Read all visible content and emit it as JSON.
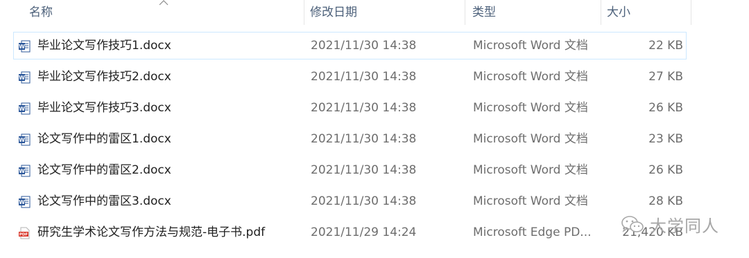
{
  "columns": {
    "name": "名称",
    "date": "修改日期",
    "type": "类型",
    "size": "大小"
  },
  "files": [
    {
      "name": "毕业论文写作技巧1.docx",
      "date": "2021/11/30 14:38",
      "type": "Microsoft Word 文档",
      "size": "22 KB",
      "icon": "word-doc-icon"
    },
    {
      "name": "毕业论文写作技巧2.docx",
      "date": "2021/11/30 14:38",
      "type": "Microsoft Word 文档",
      "size": "27 KB",
      "icon": "word-doc-icon"
    },
    {
      "name": "毕业论文写作技巧3.docx",
      "date": "2021/11/30 14:38",
      "type": "Microsoft Word 文档",
      "size": "26 KB",
      "icon": "word-doc-icon"
    },
    {
      "name": "论文写作中的雷区1.docx",
      "date": "2021/11/30 14:38",
      "type": "Microsoft Word 文档",
      "size": "23 KB",
      "icon": "word-doc-icon"
    },
    {
      "name": "论文写作中的雷区2.docx",
      "date": "2021/11/30 14:38",
      "type": "Microsoft Word 文档",
      "size": "26 KB",
      "icon": "word-doc-icon"
    },
    {
      "name": "论文写作中的雷区3.docx",
      "date": "2021/11/30 14:38",
      "type": "Microsoft Word 文档",
      "size": "28 KB",
      "icon": "word-doc-icon"
    },
    {
      "name": "研究生学术论文写作方法与规范-电子书.pdf",
      "date": "2021/11/29 14:24",
      "type": "Microsoft Edge PD...",
      "size": "21,420 KB",
      "icon": "pdf-icon"
    }
  ],
  "watermark": {
    "text": "大学同人",
    "icon": "wechat-icon"
  },
  "colors": {
    "header_text": "#4c607a",
    "focus_border": "#cce8ff",
    "word_blue": "#2b579a",
    "pdf_red": "#d9382b",
    "watermark": "#a7a7a7"
  }
}
